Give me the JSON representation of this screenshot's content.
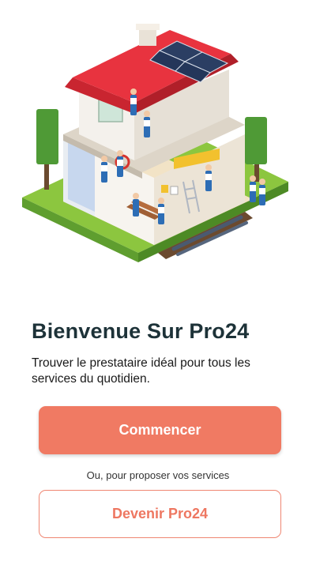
{
  "welcome": {
    "title": "Bienvenue Sur Pro24",
    "subtitle": "Trouver le prestataire idéal pour tous les services du quotidien."
  },
  "actions": {
    "start_label": "Commencer",
    "provider_prompt": "Ou, pour proposer vos services",
    "become_pro_label": "Devenir Pro24"
  },
  "illustration": {
    "subject": "house-renovation-illustration"
  },
  "colors": {
    "accent": "#f07a63",
    "title": "#1d3238",
    "roof": "#e8333f",
    "grass": "#8cc63f"
  }
}
